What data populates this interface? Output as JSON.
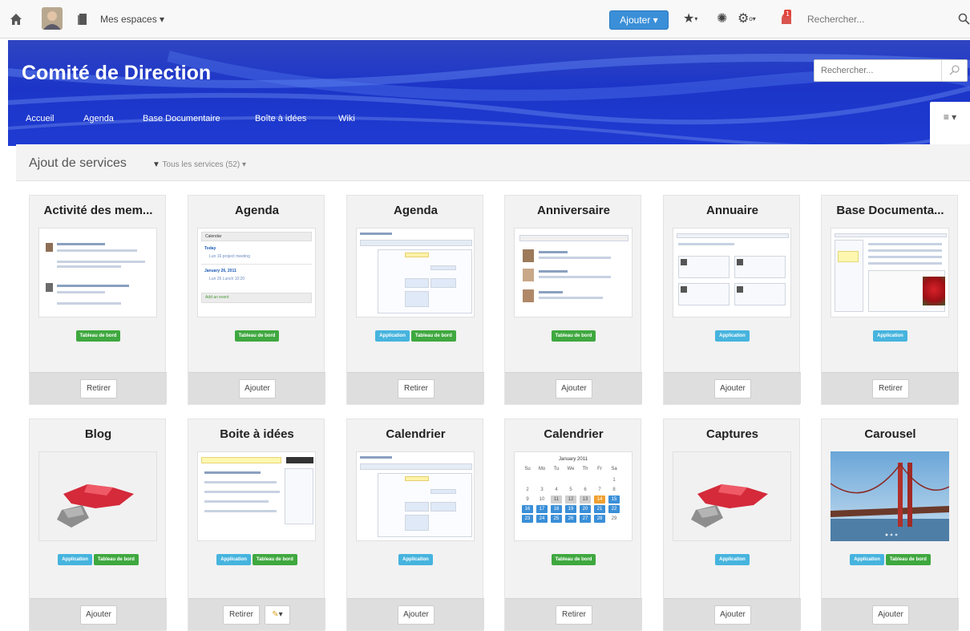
{
  "topbar": {
    "spaces_label": "Mes espaces ▾",
    "add_button": "Ajouter ▾",
    "search_placeholder": "Rechercher...",
    "notification_count": "1"
  },
  "banner": {
    "title": "Comité de Direction",
    "search_placeholder": "Rechercher..."
  },
  "nav": [
    "Accueil",
    "Agenda",
    "Base Documentaire",
    "Boîte à idées",
    "Wiki"
  ],
  "menu_button": "≡ ▾",
  "services_header": {
    "title": "Ajout de services",
    "filter": "Tous les services (52) ▾"
  },
  "cards": [
    {
      "title": "Activité des mem...",
      "tags": [
        {
          "label": "Tableau de bord",
          "color": "green"
        }
      ],
      "action": "Retirer"
    },
    {
      "title": "Agenda",
      "tags": [
        {
          "label": "Tableau de bord",
          "color": "green"
        }
      ],
      "action": "Ajouter"
    },
    {
      "title": "Agenda",
      "tags": [
        {
          "label": "Application",
          "color": "blue"
        },
        {
          "label": "Tableau de bord",
          "color": "green"
        }
      ],
      "action": "Retirer"
    },
    {
      "title": "Anniversaire",
      "tags": [
        {
          "label": "Tableau de bord",
          "color": "green"
        }
      ],
      "action": "Ajouter"
    },
    {
      "title": "Annuaire",
      "tags": [
        {
          "label": "Application",
          "color": "blue"
        }
      ],
      "action": "Ajouter"
    },
    {
      "title": "Base Documenta...",
      "tags": [
        {
          "label": "Application",
          "color": "blue"
        }
      ],
      "action": "Retirer"
    },
    {
      "title": "Blog",
      "tags": [
        {
          "label": "Application",
          "color": "blue"
        },
        {
          "label": "Tableau de bord",
          "color": "green"
        }
      ],
      "action": "Ajouter"
    },
    {
      "title": "Boite à idées",
      "tags": [
        {
          "label": "Application",
          "color": "blue"
        },
        {
          "label": "Tableau de bord",
          "color": "green"
        }
      ],
      "action": "Retirer",
      "extra": "▾"
    },
    {
      "title": "Calendrier",
      "tags": [
        {
          "label": "Application",
          "color": "blue"
        }
      ],
      "action": "Ajouter"
    },
    {
      "title": "Calendrier",
      "tags": [
        {
          "label": "Tableau de bord",
          "color": "green"
        }
      ],
      "action": "Retirer"
    },
    {
      "title": "Captures",
      "tags": [
        {
          "label": "Application",
          "color": "blue"
        }
      ],
      "action": "Ajouter"
    },
    {
      "title": "Carousel",
      "tags": [
        {
          "label": "Application",
          "color": "blue"
        },
        {
          "label": "Tableau de bord",
          "color": "green"
        }
      ],
      "action": "Ajouter"
    }
  ],
  "thumb_agenda": {
    "header": "Calendar",
    "e1_title": "Today",
    "e1_sub": "Lun 16 project meeting",
    "e2_title": "January 26, 2011",
    "e2_sub": "Lun 26 Lunch 10:20",
    "link": "Add an event"
  },
  "thumb_calendar": {
    "month": "January 2011",
    "days": [
      "Su",
      "Mo",
      "Tu",
      "We",
      "Th",
      "Fr",
      "Sa"
    ],
    "rows": [
      [
        "",
        "",
        "",
        "",
        "",
        "",
        "1"
      ],
      [
        "2",
        "3",
        "4",
        "5",
        "6",
        "7",
        "8"
      ],
      [
        "9",
        "10",
        "11",
        "12",
        "13",
        "14",
        "15"
      ],
      [
        "16",
        "17",
        "18",
        "19",
        "20",
        "21",
        "22"
      ],
      [
        "23",
        "24",
        "25",
        "26",
        "27",
        "28",
        "29"
      ]
    ]
  },
  "colors": {
    "tag_green": "#3fa83f",
    "tag_blue": "#46b4de",
    "banner": "#1e3bd2",
    "add_button": "#3a8fd8"
  }
}
